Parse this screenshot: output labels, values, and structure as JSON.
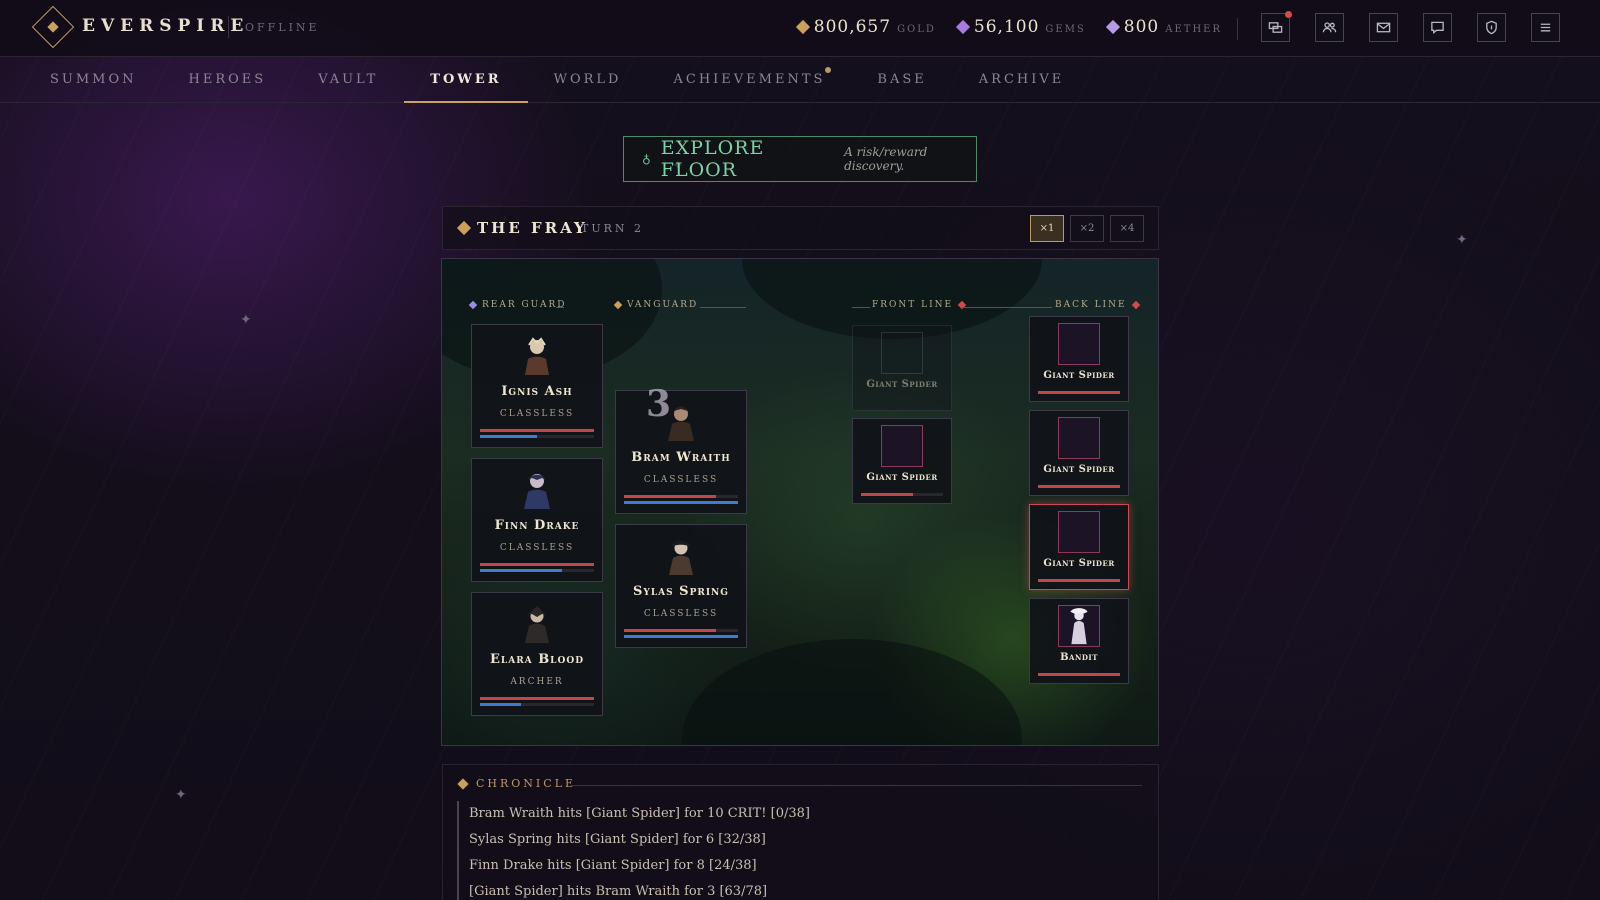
{
  "header": {
    "brand": "EVERSPIRE",
    "status": "OFFLINE",
    "currencies": [
      {
        "value": "800,657",
        "label": "GOLD",
        "color": "#c9a15a"
      },
      {
        "value": "56,100",
        "label": "GEMS",
        "color": "#a77ae0"
      },
      {
        "value": "800",
        "label": "AETHER",
        "color": "#b49ae8"
      }
    ],
    "icons": [
      "squads-icon",
      "friends-icon",
      "mail-icon",
      "chat-icon",
      "shield-icon",
      "menu-icon"
    ]
  },
  "nav": {
    "items": [
      "SUMMON",
      "HEROES",
      "VAULT",
      "TOWER",
      "WORLD",
      "ACHIEVEMENTS",
      "BASE",
      "ARCHIVE"
    ],
    "active": "TOWER"
  },
  "explore": {
    "title": "EXPLORE FLOOR",
    "subtitle": "A risk/reward discovery."
  },
  "fray": {
    "title": "THE FRAY",
    "turn": "TURN 2",
    "speeds": [
      "×1",
      "×2",
      "×4"
    ],
    "active_speed": "×1"
  },
  "battle": {
    "labels": {
      "rear_guard": "REAR GUARD",
      "vanguard": "VANGUARD",
      "front_line": "FRONT LINE",
      "back_line": "BACK LINE"
    },
    "rear_guard": [
      {
        "name": "Ignis Ash",
        "class": "CLASSLESS",
        "hp": 1.0,
        "mp": 0.5
      },
      {
        "name": "Finn Drake",
        "class": "CLASSLESS",
        "hp": 1.0,
        "mp": 0.72
      },
      {
        "name": "Elara Blood",
        "class": "ARCHER",
        "hp": 1.0,
        "mp": 0.36
      }
    ],
    "vanguard": [
      {
        "name": "Bram Wraith",
        "class": "CLASSLESS",
        "hp": 0.81,
        "mp": 1.0,
        "turn_marker": "3"
      },
      {
        "name": "Sylas Spring",
        "class": "CLASSLESS",
        "hp": 0.81,
        "mp": 1.0
      }
    ],
    "front_line": [
      {
        "name": "Giant Spider",
        "hp": 0.0,
        "dead": true
      },
      {
        "name": "Giant Spider",
        "hp": 0.63,
        "dead": false
      }
    ],
    "back_line": [
      {
        "name": "Giant Spider",
        "hp": 1.0,
        "dead": false
      },
      {
        "name": "Giant Spider",
        "hp": 1.0,
        "dead": false
      },
      {
        "name": "Giant Spider",
        "hp": 1.0,
        "dead": false,
        "targeted": true
      },
      {
        "name": "Bandit",
        "hp": 1.0,
        "dead": false
      }
    ]
  },
  "chronicle": {
    "title": "CHRONICLE",
    "entries": [
      "Bram Wraith hits [Giant Spider] for 10 CRIT! [0/38]",
      "Sylas Spring hits [Giant Spider] for 6 [32/38]",
      "Finn Drake hits [Giant Spider] for 8 [24/38]",
      "[Giant Spider] hits Bram Wraith for 3 [63/78]"
    ]
  }
}
